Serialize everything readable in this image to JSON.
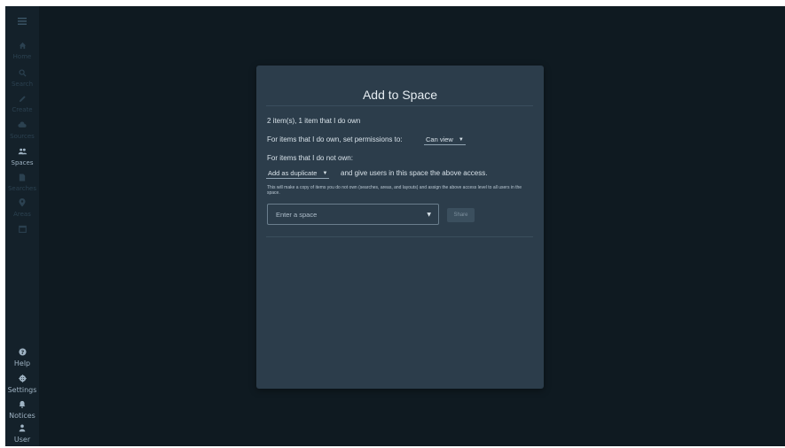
{
  "sidebar": {
    "menu_icon": "hamburger-icon",
    "items": [
      {
        "label": "Home",
        "icon": "home-icon"
      },
      {
        "label": "Search",
        "icon": "search-icon"
      },
      {
        "label": "Create",
        "icon": "pencil-icon"
      },
      {
        "label": "Sources",
        "icon": "cloud-icon"
      },
      {
        "label": "Spaces",
        "icon": "people-icon"
      },
      {
        "label": "Searches",
        "icon": "document-icon"
      },
      {
        "label": "Areas",
        "icon": "map-pin-icon"
      },
      {
        "label": "",
        "icon": "calendar-icon"
      }
    ],
    "bottom_items": [
      {
        "label": "Help",
        "icon": "help-icon"
      },
      {
        "label": "Settings",
        "icon": "gear-icon"
      },
      {
        "label": "Notices",
        "icon": "bell-icon"
      },
      {
        "label": "User",
        "icon": "user-icon"
      }
    ]
  },
  "modal": {
    "title": "Add to Space",
    "summary": "2 item(s), 1 item that I do own",
    "own_label": "For items that I do own, set permissions to:",
    "own_permission": "Can view",
    "not_own_label": "For items that I do not own:",
    "not_own_mode": "Add as duplicate",
    "not_own_suffix": "and give users in this space the above access.",
    "note": "This will make a copy of items you do not own (searches, areas, and layouts) and assign the above access level to all users in the space.",
    "space_placeholder": "Enter a space",
    "share_label": "Share"
  },
  "colors": {
    "background": "#0f1a21",
    "sidebar": "#14212a",
    "modal": "#2c3d4b"
  }
}
